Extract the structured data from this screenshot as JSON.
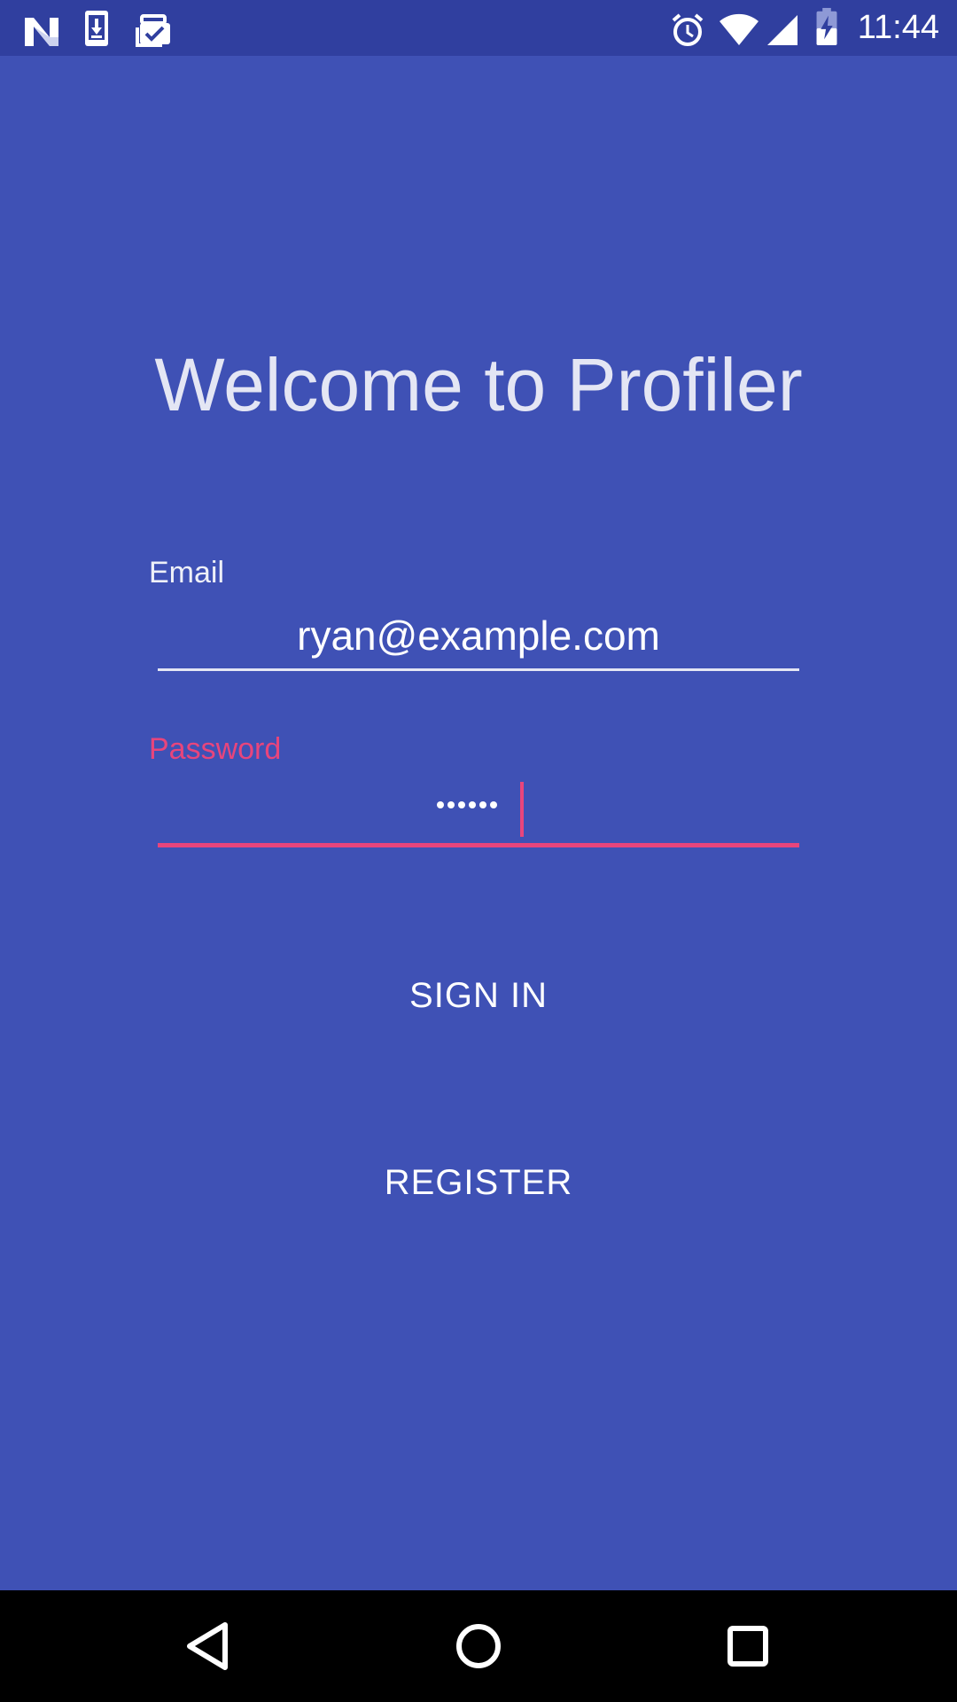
{
  "status_bar": {
    "time": "11:44",
    "icons": [
      "n-logo-icon",
      "download-phone-icon",
      "briefcase-check-icon",
      "alarm-icon",
      "wifi-icon",
      "cell-signal-icon",
      "battery-charging-icon"
    ]
  },
  "welcome": {
    "title": "Welcome to Profiler"
  },
  "email": {
    "label": "Email",
    "value": "ryan@example.com"
  },
  "password": {
    "label": "Password",
    "masked_length": 6
  },
  "buttons": {
    "sign_in": "SIGN IN",
    "register": "REGISTER"
  },
  "nav_bar": {
    "icons": [
      "back-icon",
      "home-icon",
      "recents-icon"
    ]
  },
  "colors": {
    "background": "#3F51B5",
    "status_bar": "#303F9F",
    "accent": "#E8457C"
  }
}
